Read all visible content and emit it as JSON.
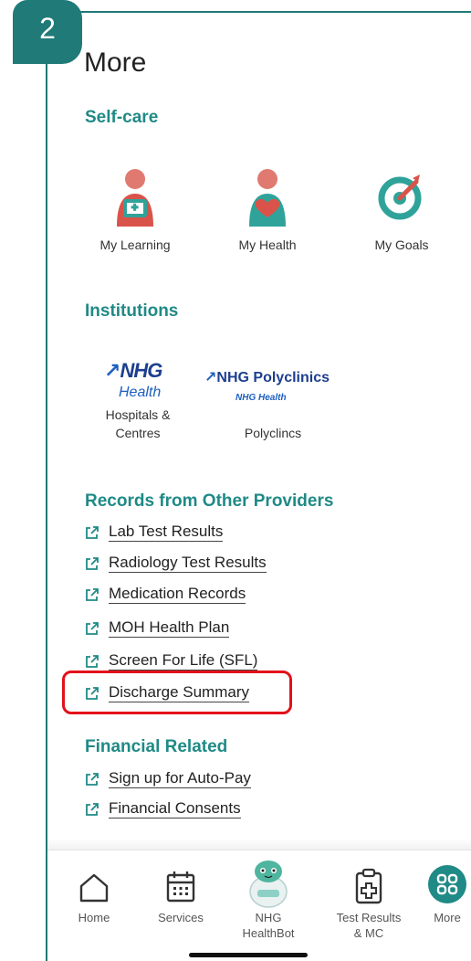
{
  "step": {
    "number": "2"
  },
  "page": {
    "title": "More"
  },
  "self_care": {
    "heading": "Self-care",
    "items": [
      {
        "label": "My Learning",
        "icon": "learning-person-icon"
      },
      {
        "label": "My Health",
        "icon": "health-person-icon"
      },
      {
        "label": "My Goals",
        "icon": "target-goal-icon"
      }
    ]
  },
  "institutions": {
    "heading": "Institutions",
    "items": [
      {
        "logo_main": "NHG",
        "logo_sub": "Health",
        "label": "Hospitals &\nCentres"
      },
      {
        "logo_main": "NHG Polyclinics",
        "logo_sub": "NHG Health",
        "label": "Polyclincs"
      }
    ]
  },
  "records": {
    "heading": "Records from Other Providers",
    "links": [
      "Lab Test Results",
      "Radiology Test Results",
      "Medication Records",
      "MOH Health Plan",
      "Screen For Life (SFL)",
      "Discharge Summary"
    ]
  },
  "financial": {
    "heading": "Financial Related",
    "links": [
      "Sign up for Auto-Pay",
      "Financial Consents"
    ]
  },
  "bottom_nav": {
    "items": [
      {
        "label": "Home",
        "icon": "home-icon"
      },
      {
        "label": "Services",
        "icon": "calendar-icon"
      },
      {
        "label": "NHG\nHealthBot",
        "icon": "healthbot-icon"
      },
      {
        "label": "Test Results\n& MC",
        "icon": "clipboard-icon"
      },
      {
        "label": "More",
        "icon": "grid-icon",
        "active": true
      }
    ]
  },
  "colors": {
    "accent": "#1f8a86",
    "frame": "#1f7a78",
    "highlight": "#e3101a",
    "figure_red": "#d9534a"
  }
}
